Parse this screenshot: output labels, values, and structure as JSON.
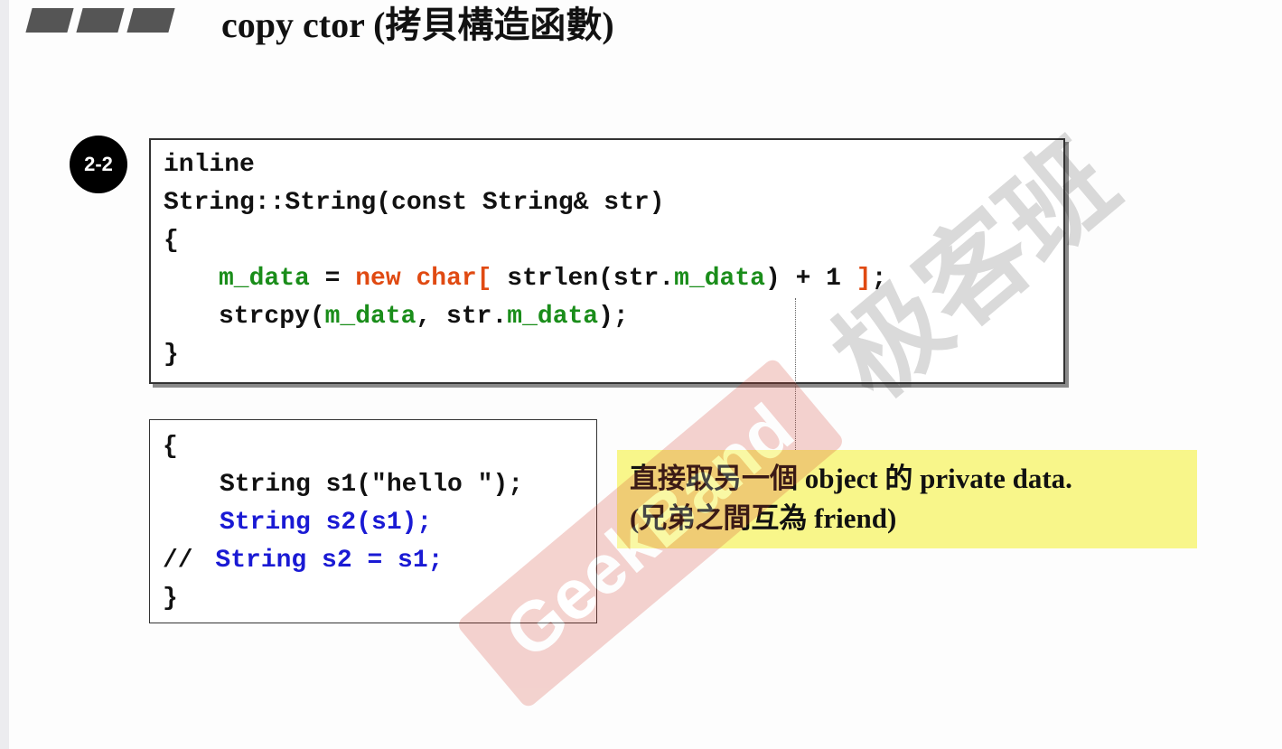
{
  "slide": {
    "title": "copy ctor (拷貝構造函數)",
    "badge": "2-2"
  },
  "code_top": {
    "l1": "inline",
    "l2": "String::String(const String& str)",
    "l3": "{",
    "l4": {
      "a": "m_data",
      "b": " = ",
      "c": "new",
      "d": " ",
      "e": "char[",
      "f": " strlen(str.",
      "g": "m_data",
      "h": ") + 1 ",
      "i": "]",
      "j": ";"
    },
    "l5": {
      "a": "strcpy(",
      "b": "m_data",
      "c": ", str.",
      "d": "m_data",
      "e": ");"
    },
    "l6": "}"
  },
  "code_bottom": {
    "l1": "{",
    "l2": "String s1(\"hello \");",
    "l3": "String s2(s1);",
    "l4a": "// ",
    "l4b": "String s2 = s1;",
    "l5": "}"
  },
  "note": {
    "line1": "直接取另一個 object 的 private data.",
    "line2": "(兄弟之間互為 friend)"
  },
  "watermark": {
    "text_cn": "极客班",
    "text_en": "GeekBand"
  },
  "colors": {
    "green": "#1a8d1a",
    "red": "#e04a12",
    "blue": "#1a1ad4",
    "note_bg": "#f8f68a",
    "watermark": "#d23a2a"
  }
}
